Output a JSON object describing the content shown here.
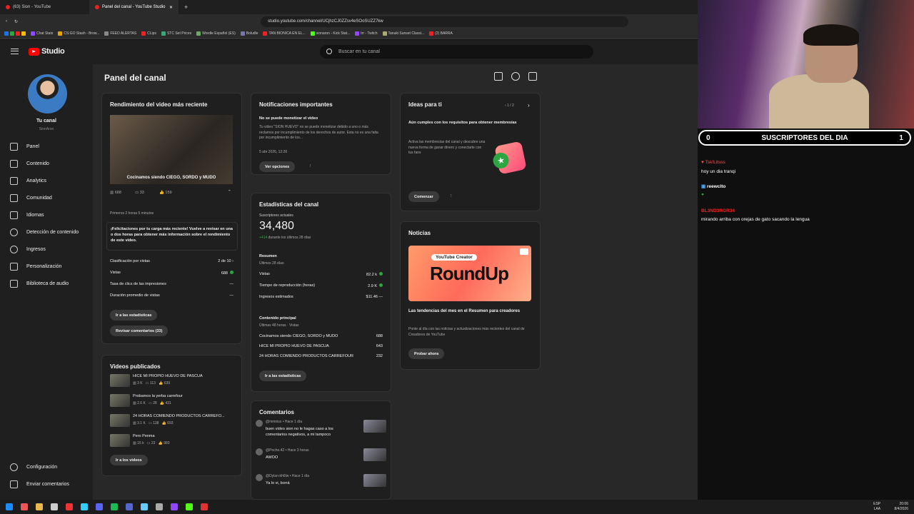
{
  "browser": {
    "tabs": [
      {
        "label": "(63) Sion - YouTube"
      },
      {
        "label": "Panel del canal - YouTube Studio"
      }
    ],
    "url": "studio.youtube.com/channel/UCjhzCJ0ZZsv4eSOoSUZZ7kw",
    "bookmarks": [
      "Chat Stats",
      "CS:GO Stash - Brow...",
      "FEED ALERTAS",
      "CLips",
      "STC Set Prices",
      "Wordle Español (ES)",
      "Boludle",
      "TAN BIONICA EN EL...",
      "sionaron - Kick Stat...",
      "trr - Twitch",
      "Tanuki Sunset Classi...",
      "(2) BARRA"
    ]
  },
  "header": {
    "logo_text": "Studio",
    "search_placeholder": "Buscar en tu canal"
  },
  "sidebar": {
    "channel_name": "Tu canal",
    "channel_handle": "SionAron",
    "items": [
      {
        "label": "Panel"
      },
      {
        "label": "Contenido"
      },
      {
        "label": "Analytics"
      },
      {
        "label": "Comunidad"
      },
      {
        "label": "Idiomas"
      },
      {
        "label": "Detección de contenido"
      },
      {
        "label": "Ingresos"
      },
      {
        "label": "Personalización"
      },
      {
        "label": "Biblioteca de audio"
      }
    ],
    "bottom": [
      {
        "label": "Configuración"
      },
      {
        "label": "Enviar comentarios"
      }
    ]
  },
  "page": {
    "title": "Panel del canal"
  },
  "latest_video": {
    "heading": "Rendimiento del video más reciente",
    "title_overlay": "Cocinamos siendo CIEGO, SORDO y MUDO",
    "views": "688",
    "comments": "33",
    "likes": "159",
    "period": "Primeros 2 horas 5 minutos",
    "congrats": "¡Felicitaciones por tu carga más reciente! Vuelve a revisar en una o dos horas para obtener más información sobre el rendimiento de este video.",
    "stats": [
      {
        "label": "Clasificación por vistas",
        "value": "2 de 10"
      },
      {
        "label": "Vistas",
        "value": "688"
      },
      {
        "label": "Tasa de clics de las impresiones",
        "value": "—"
      },
      {
        "label": "Duración promedio de vistas",
        "value": "—"
      }
    ],
    "btn_stats": "Ir a las estadísticas",
    "btn_comments": "Revisar comentarios (33)"
  },
  "published": {
    "heading": "Videos publicados",
    "videos": [
      {
        "title": "HICE MI PROPIO HUEVO DE PASCUA",
        "views": "3 K",
        "comments": "113",
        "likes": "639"
      },
      {
        "title": "Probamos la yerba carrefour",
        "views": "2.6 K",
        "comments": "28",
        "likes": "431"
      },
      {
        "title": "24 HORAS COMIENDO PRODUCTOS CARREFO...",
        "views": "3.1 K",
        "comments": "138",
        "likes": "693"
      },
      {
        "title": "Pero Penma",
        "views": "15 k",
        "comments": "23",
        "likes": "983"
      }
    ],
    "btn": "Ir a los videos"
  },
  "notifications": {
    "heading": "Notificaciones importantes",
    "title": "No se puede monetizar el video",
    "body": "Tu video \"SION HUEVO\" no se puede monetizar debido a uno o más reclamos por incumplimiento de los derechos de autor. Esta no es una falta por incumplimiento de los...",
    "date": "5 abr 2026, 12:26",
    "btn": "Ver opciones"
  },
  "channel_stats": {
    "heading": "Estadísticas del canal",
    "subs_label": "Suscriptores actuales",
    "subs": "34,480",
    "subs_change": "+414",
    "subs_change_text": "durante los últimos 28 días",
    "summary_title": "Resumen",
    "summary_period": "Últimos 28 días",
    "rows": [
      {
        "label": "Vistas",
        "value": "82.2 k"
      },
      {
        "label": "Tiempo de reproducción (horas)",
        "value": "2.9 K"
      },
      {
        "label": "Ingresos estimados",
        "value": "$11.46"
      }
    ],
    "top_title": "Contenido principal",
    "top_period": "Últimas 48 horas · Vistas",
    "top": [
      {
        "label": "Cocinamos siendo CIEGO, SORDO y MUDO",
        "value": "688"
      },
      {
        "label": "HICE MI PROPIO HUEVO DE PASCUA",
        "value": "643"
      },
      {
        "label": "24 HORAS COMIENDO PRODUCTOS CARREFOUR",
        "value": "232"
      }
    ],
    "btn": "Ir a las estadísticas"
  },
  "comments": {
    "heading": "Comentarios",
    "items": [
      {
        "author": "@mmnisx",
        "time": "Hace 1 día",
        "text": "buen video sion no le hagas caso a los comentarios negativos, a mi tampoco"
      },
      {
        "author": "@Pocho.42",
        "time": "Hace 3 horas",
        "text": "AWOO"
      },
      {
        "author": "@Dylan-kh6lw",
        "time": "Hace 1 día",
        "text": "Ya lo vi, borrá"
      }
    ]
  },
  "ideas": {
    "heading": "Ideas para ti",
    "pager": "1 / 2",
    "title": "Aún cumples con los requisitos para obtener membresías",
    "body": "Activa las membresías del canal y descubre una nueva forma de ganar dinero y conectarte con tus fans",
    "btn": "Comenzar"
  },
  "news": {
    "heading": "Noticias",
    "banner_tag": "YouTube Creator",
    "banner_big": "RoundUp",
    "title": "Las tendencias del mes en el Resumen para creadores",
    "body": "Ponte al día con las noticias y actualizaciones más recientes del canal de Creadores de YouTube",
    "btn": "Probar ahora"
  },
  "stream": {
    "sub_left": "0",
    "sub_label": "SUSCRIPTORES DEL DIA",
    "sub_right": "1",
    "chat": [
      {
        "user": "Tsk!Litsss",
        "color": "#ff4d4d",
        "text": "hoy un dia tranqi"
      },
      {
        "user": "reewclto",
        "color": "#ffffff",
        "text": ""
      },
      {
        "user": "BL3ND3RGR34",
        "color": "#ff2020",
        "text": "mirando arriba con orejas de gato sacando la lengua"
      }
    ]
  },
  "taskbar": {
    "lang1": "ESP",
    "lang2": "LAA",
    "time": "20:06",
    "date": "8/4/2026"
  }
}
